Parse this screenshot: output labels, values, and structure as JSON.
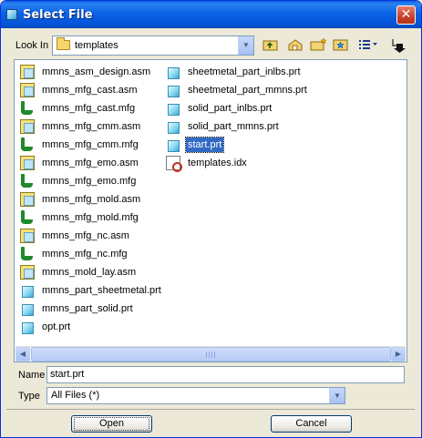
{
  "window": {
    "title": "Select File"
  },
  "toolbar": {
    "lookin_label": "Look In",
    "lookin_value": "templates",
    "icons": [
      "up-folder-icon",
      "home-folder-icon",
      "new-folder-icon",
      "favorites-folder-icon",
      "view-menu-icon",
      "sort-icon"
    ]
  },
  "files": {
    "column1": [
      {
        "name": "mmns_asm_design.asm",
        "type": "asm"
      },
      {
        "name": "mmns_mfg_cast.asm",
        "type": "asm"
      },
      {
        "name": "mmns_mfg_cast.mfg",
        "type": "mfg"
      },
      {
        "name": "mmns_mfg_cmm.asm",
        "type": "asm"
      },
      {
        "name": "mmns_mfg_cmm.mfg",
        "type": "mfg"
      },
      {
        "name": "mmns_mfg_emo.asm",
        "type": "asm"
      },
      {
        "name": "mmns_mfg_emo.mfg",
        "type": "mfg"
      },
      {
        "name": "mmns_mfg_mold.asm",
        "type": "asm"
      },
      {
        "name": "mmns_mfg_mold.mfg",
        "type": "mfg"
      },
      {
        "name": "mmns_mfg_nc.asm",
        "type": "asm"
      },
      {
        "name": "mmns_mfg_nc.mfg",
        "type": "mfg"
      },
      {
        "name": "mmns_mold_lay.asm",
        "type": "asm"
      },
      {
        "name": "mmns_part_sheetmetal.prt",
        "type": "prt"
      },
      {
        "name": "mmns_part_solid.prt",
        "type": "prt"
      },
      {
        "name": "opt.prt",
        "type": "prt"
      }
    ],
    "column2": [
      {
        "name": "sheetmetal_part_inlbs.prt",
        "type": "prt"
      },
      {
        "name": "sheetmetal_part_mmns.prt",
        "type": "prt"
      },
      {
        "name": "solid_part_inlbs.prt",
        "type": "prt"
      },
      {
        "name": "solid_part_mmns.prt",
        "type": "prt"
      },
      {
        "name": "start.prt",
        "type": "prt",
        "selected": true
      },
      {
        "name": "templates.idx",
        "type": "idx"
      }
    ]
  },
  "form": {
    "name_label": "Name",
    "name_value": "start.prt",
    "type_label": "Type",
    "type_value": "All Files (*)"
  },
  "buttons": {
    "open": "Open",
    "cancel": "Cancel"
  }
}
